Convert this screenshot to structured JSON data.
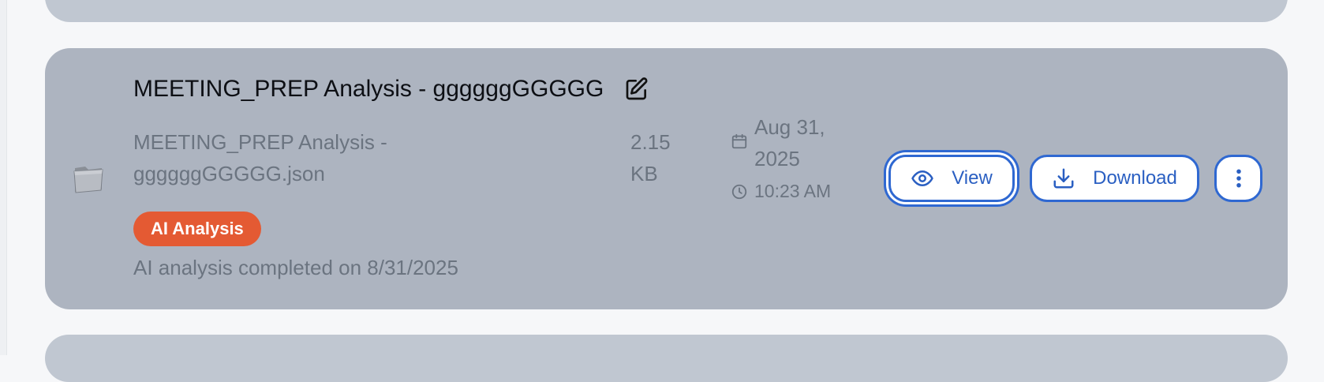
{
  "card": {
    "title": "MEETING_PREP Analysis - ggggggGGGGG",
    "filename": "MEETING_PREP Analysis - ggggggGGGGG.json",
    "size": "2.15 KB",
    "date": "Aug 31, 2025",
    "time": "10:23 AM",
    "badge": "AI Analysis",
    "status": "AI analysis completed on 8/31/2025",
    "icons": {
      "file": "folder-icon",
      "edit": "edit-icon",
      "date": "calendar-icon",
      "time": "clock-icon",
      "view": "eye-icon",
      "download": "download-icon",
      "more": "more-vertical-icon"
    }
  },
  "actions": {
    "view_label": "View",
    "download_label": "Download"
  },
  "colors": {
    "card_background": "#adb4c0",
    "adjacent_card_background": "#c0c7d1",
    "badge": "#e45a33",
    "accent": "#2f68d1",
    "muted_text": "#6b7480"
  }
}
